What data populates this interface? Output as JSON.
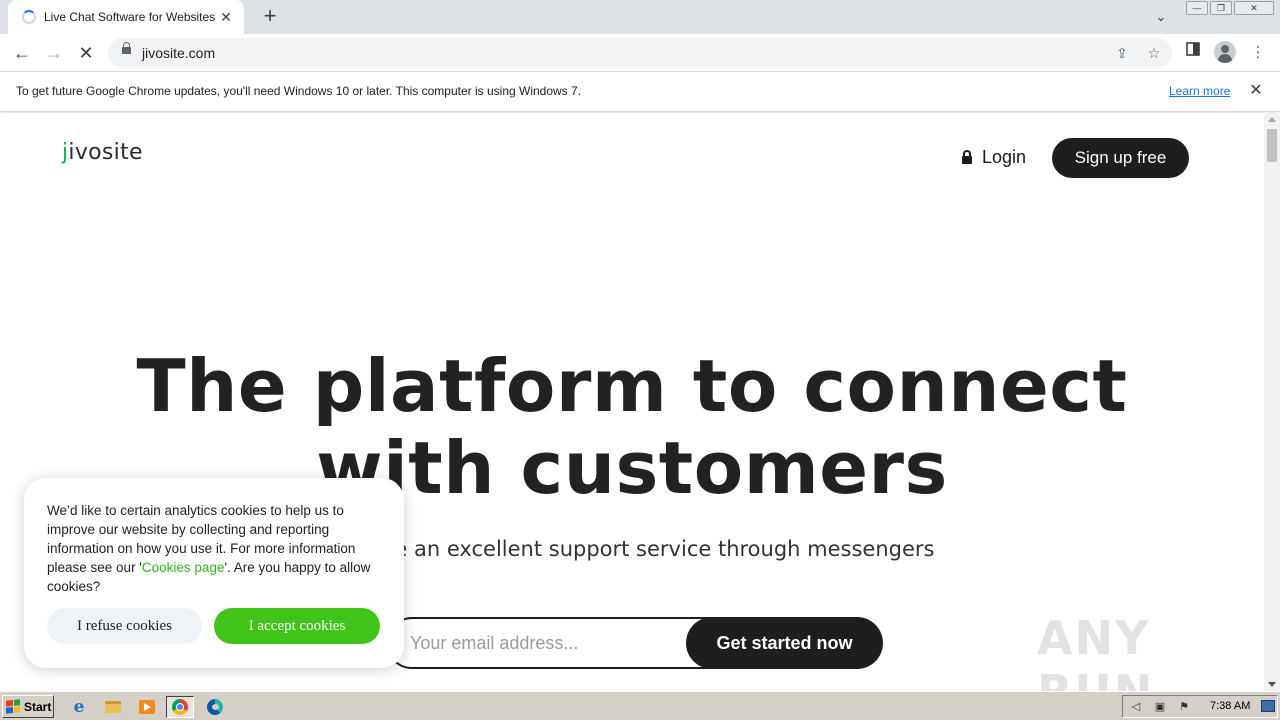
{
  "browser": {
    "tab_title": "Live Chat Software for Websites | Ji",
    "tab_close": "✕",
    "new_tab": "+",
    "url": "jivosite.com",
    "window_controls": {
      "minimize": "—",
      "restore": "❐",
      "close": "✕"
    },
    "icons": [
      "back-icon",
      "forward-icon",
      "stop-icon",
      "lock-icon",
      "share-icon",
      "star-icon",
      "side-panel-icon",
      "profile-icon",
      "menu-icon"
    ]
  },
  "infobar": {
    "message": "To get future Google Chrome updates, you'll need Windows 10 or later. This computer is using Windows 7.",
    "link": "Learn more",
    "close": "✕"
  },
  "page": {
    "logo": {
      "j": "j",
      "rest": "ivosite"
    },
    "login": "Login",
    "signup": "Sign up free",
    "hero_line1": "The platform to connect",
    "hero_line2": "with customers",
    "subtitle": "Provide an excellent support service through messengers",
    "email_placeholder": "Your email address...",
    "cta": "Get started now",
    "colors": {
      "brand_green": "#0db04b",
      "dark": "#1e1e1e",
      "accept_green": "#41c41a"
    }
  },
  "cookie_banner": {
    "text_before": "We’d like to certain analytics cookies to help us to improve our website by collecting and reporting information on how you use it. For more information please see our '",
    "link": "Cookies page",
    "text_after": "'. Are you happy to allow cookies?",
    "refuse": "I refuse cookies",
    "accept": "I accept cookies"
  },
  "watermark": "ANY RUN",
  "taskbar": {
    "start": "Start",
    "clock": "7:38 AM",
    "apps": [
      "ie-icon",
      "explorer-icon",
      "media-player-icon",
      "chrome-icon",
      "edge-icon"
    ]
  }
}
